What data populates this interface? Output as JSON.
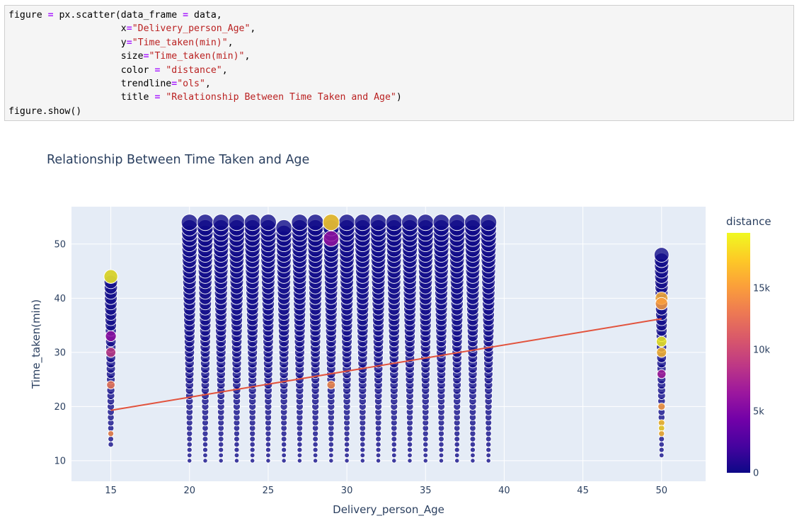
{
  "notebook": {
    "code_lines": [
      [
        {
          "t": "plain",
          "s": "figure "
        },
        {
          "t": "op",
          "s": "="
        },
        {
          "t": "plain",
          "s": " px.scatter(data_frame "
        },
        {
          "t": "op",
          "s": "="
        },
        {
          "t": "plain",
          "s": " data,"
        }
      ],
      [
        {
          "t": "plain",
          "s": "                    x"
        },
        {
          "t": "op",
          "s": "="
        },
        {
          "t": "str",
          "s": "\"Delivery_person_Age\""
        },
        {
          "t": "plain",
          "s": ","
        }
      ],
      [
        {
          "t": "plain",
          "s": "                    y"
        },
        {
          "t": "op",
          "s": "="
        },
        {
          "t": "str",
          "s": "\"Time_taken(min)\""
        },
        {
          "t": "plain",
          "s": ","
        }
      ],
      [
        {
          "t": "plain",
          "s": "                    size"
        },
        {
          "t": "op",
          "s": "="
        },
        {
          "t": "str",
          "s": "\"Time_taken(min)\""
        },
        {
          "t": "plain",
          "s": ","
        }
      ],
      [
        {
          "t": "plain",
          "s": "                    color "
        },
        {
          "t": "op",
          "s": "="
        },
        {
          "t": "plain",
          "s": " "
        },
        {
          "t": "str",
          "s": "\"distance\""
        },
        {
          "t": "plain",
          "s": ","
        }
      ],
      [
        {
          "t": "plain",
          "s": "                    trendline"
        },
        {
          "t": "op",
          "s": "="
        },
        {
          "t": "str",
          "s": "\"ols\""
        },
        {
          "t": "plain",
          "s": ","
        }
      ],
      [
        {
          "t": "plain",
          "s": "                    title "
        },
        {
          "t": "op",
          "s": "="
        },
        {
          "t": "plain",
          "s": " "
        },
        {
          "t": "str",
          "s": "\"Relationship Between Time Taken and Age\""
        },
        {
          "t": "plain",
          "s": ")"
        }
      ],
      [
        {
          "t": "plain",
          "s": "figure.show()"
        }
      ]
    ]
  },
  "chart_data": {
    "type": "scatter",
    "title": "Relationship Between Time Taken and Age",
    "xlabel": "Delivery_person_Age",
    "ylabel": "Time_taken(min)",
    "xlim": [
      12.5,
      52.8
    ],
    "ylim": [
      6.2,
      56.9
    ],
    "xticks": [
      15,
      20,
      25,
      30,
      35,
      40,
      45,
      50
    ],
    "yticks": [
      10,
      20,
      30,
      40,
      50
    ],
    "grid": true,
    "ages": [
      15,
      20,
      21,
      22,
      23,
      24,
      25,
      26,
      27,
      28,
      29,
      30,
      31,
      32,
      33,
      34,
      35,
      36,
      37,
      38,
      39,
      50
    ],
    "time_ranges": [
      [
        13,
        44
      ],
      [
        10,
        54
      ],
      [
        10,
        54
      ],
      [
        10,
        54
      ],
      [
        10,
        54
      ],
      [
        10,
        54
      ],
      [
        10,
        54
      ],
      [
        10,
        53
      ],
      [
        10,
        54
      ],
      [
        10,
        54
      ],
      [
        10,
        54
      ],
      [
        10,
        54
      ],
      [
        10,
        54
      ],
      [
        10,
        54
      ],
      [
        10,
        54
      ],
      [
        10,
        54
      ],
      [
        10,
        54
      ],
      [
        10,
        54
      ],
      [
        10,
        54
      ],
      [
        10,
        54
      ],
      [
        10,
        54
      ],
      [
        11,
        48
      ]
    ],
    "highlighted_points": [
      {
        "x": 15,
        "y": 44,
        "distance": 19000
      },
      {
        "x": 15,
        "y": 33,
        "distance": 6000
      },
      {
        "x": 15,
        "y": 30,
        "distance": 9000
      },
      {
        "x": 15,
        "y": 24,
        "distance": 13000
      },
      {
        "x": 15,
        "y": 15,
        "distance": 14000
      },
      {
        "x": 29,
        "y": 54,
        "distance": 17500
      },
      {
        "x": 29,
        "y": 51,
        "distance": 6000
      },
      {
        "x": 29,
        "y": 24,
        "distance": 14000
      },
      {
        "x": 50,
        "y": 40,
        "distance": 16000
      },
      {
        "x": 50,
        "y": 39,
        "distance": 15000
      },
      {
        "x": 50,
        "y": 32,
        "distance": 19000
      },
      {
        "x": 50,
        "y": 30,
        "distance": 16500
      },
      {
        "x": 50,
        "y": 26,
        "distance": 7000
      },
      {
        "x": 50,
        "y": 20,
        "distance": 15000
      },
      {
        "x": 50,
        "y": 17,
        "distance": 17000
      },
      {
        "x": 50,
        "y": 16,
        "distance": 18000
      },
      {
        "x": 50,
        "y": 15,
        "distance": 16500
      }
    ],
    "size_field": "Time_taken(min)",
    "color_field": "distance",
    "colorbar": {
      "title": "distance",
      "range": [
        0,
        19500
      ],
      "ticks": [
        {
          "value": 0,
          "label": "0"
        },
        {
          "value": 5000,
          "label": "5k"
        },
        {
          "value": 10000,
          "label": "10k"
        },
        {
          "value": 15000,
          "label": "15k"
        }
      ],
      "colorscale": [
        "#0d0887",
        "#46039f",
        "#7201a8",
        "#9c179e",
        "#bd3786",
        "#d8576b",
        "#ed7953",
        "#fb9f3a",
        "#fdca26",
        "#f0f921"
      ]
    },
    "trendline": {
      "type": "ols",
      "x": [
        15,
        50
      ],
      "y": [
        19.3,
        36.2
      ],
      "color": "#e2533d"
    },
    "colors": {
      "plot_bg": "#e5ecf6",
      "marker_default": "#0d0887",
      "axis_text": "#2a3f5f"
    }
  }
}
